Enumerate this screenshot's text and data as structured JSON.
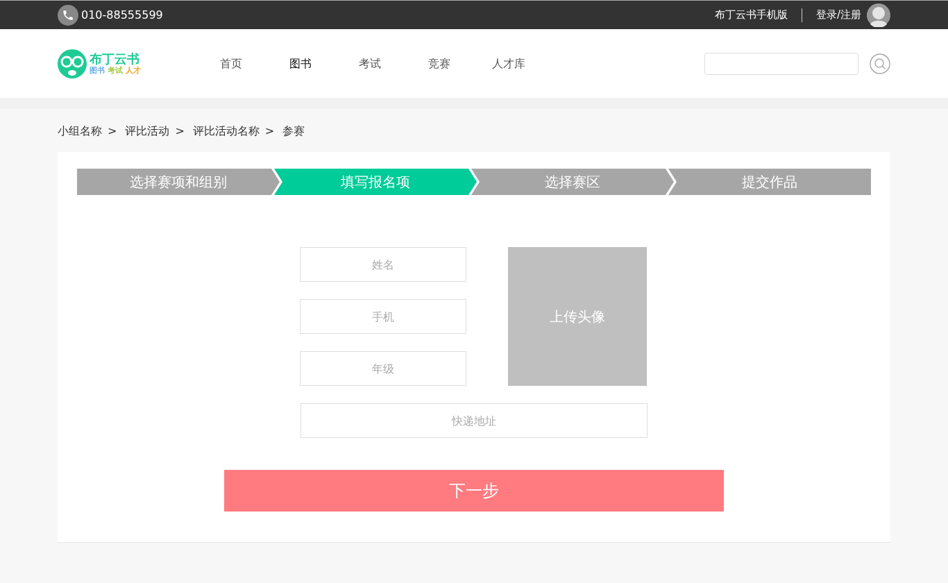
{
  "topbar": {
    "phone": "010-88555599",
    "mobile_link": "布丁云书手机版",
    "login_link": "登录/注册"
  },
  "logo": {
    "title": "布丁云书",
    "tags": [
      {
        "text": "图书",
        "color": "#6aaee8"
      },
      {
        "text": "考试",
        "color": "#a8c94a"
      },
      {
        "text": "人才",
        "color": "#f5a623"
      }
    ]
  },
  "nav": [
    {
      "label": "首页",
      "selected": false
    },
    {
      "label": "图书",
      "selected": true
    },
    {
      "label": "考试",
      "selected": false
    },
    {
      "label": "竞赛",
      "selected": false
    },
    {
      "label": "人才库",
      "selected": false
    }
  ],
  "breadcrumb": [
    {
      "label": "小组名称",
      "separator": ">"
    },
    {
      "label": "评比活动",
      "separator": ">"
    },
    {
      "label": "评比活动名称",
      "separator": ">"
    },
    {
      "label": "参赛"
    }
  ],
  "steps": [
    {
      "label": "选择赛项和组别",
      "selected": false
    },
    {
      "label": "填写报名项",
      "selected": true
    },
    {
      "label": "选择赛区",
      "selected": false
    },
    {
      "label": "提交作品",
      "selected": false
    }
  ],
  "fields": [
    {
      "placeholder": "姓名"
    },
    {
      "placeholder": "手机"
    },
    {
      "placeholder": "年级"
    }
  ],
  "upload": {
    "label": "上传头像"
  },
  "address": {
    "placeholder": "快递地址"
  },
  "next_button": "下一步"
}
